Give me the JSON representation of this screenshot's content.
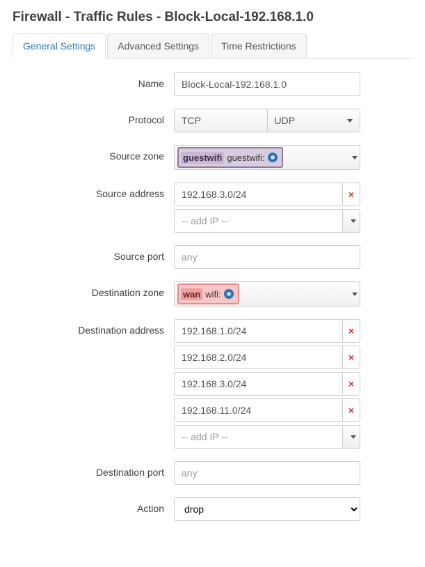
{
  "page_title": "Firewall - Traffic Rules - Block-Local-192.168.1.0",
  "tabs": [
    {
      "label": "General Settings",
      "active": true
    },
    {
      "label": "Advanced Settings",
      "active": false
    },
    {
      "label": "Time Restrictions",
      "active": false
    }
  ],
  "fields": {
    "name": {
      "label": "Name",
      "value": "Block-Local-192.168.1.0"
    },
    "protocol": {
      "label": "Protocol",
      "value1": "TCP",
      "value2": "UDP"
    },
    "source_zone": {
      "label": "Source zone",
      "zone_name": "guestwifi",
      "iface": "guestwifi:"
    },
    "source_address": {
      "label": "Source address",
      "items": [
        "192.168.3.0/24"
      ],
      "add_placeholder": "-- add IP --"
    },
    "source_port": {
      "label": "Source port",
      "placeholder": "any",
      "value": ""
    },
    "destination_zone": {
      "label": "Destination zone",
      "zone_name": "wan",
      "iface": "wifi:"
    },
    "destination_address": {
      "label": "Destination address",
      "items": [
        "192.168.1.0/24",
        "192.168.2.0/24",
        "192.168.3.0/24",
        "192.168.11.0/24"
      ],
      "add_placeholder": "-- add IP --"
    },
    "destination_port": {
      "label": "Destination port",
      "placeholder": "any",
      "value": ""
    },
    "action": {
      "label": "Action",
      "value": "drop"
    }
  }
}
